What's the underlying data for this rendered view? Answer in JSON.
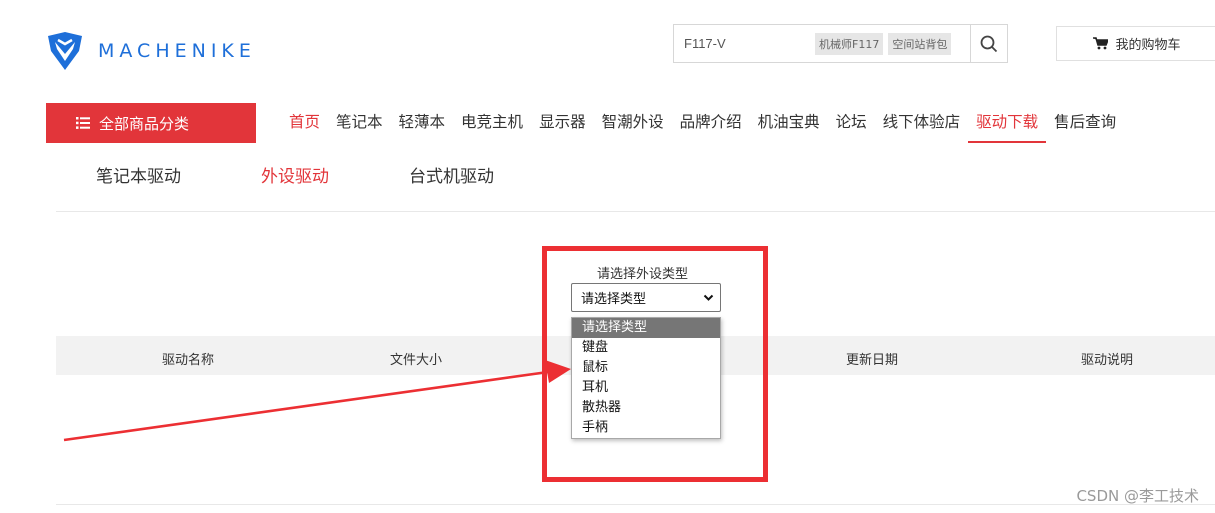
{
  "brand": {
    "name": "MACHENIKE"
  },
  "search": {
    "value": "",
    "placeholder": "F117-V",
    "hot_tags": [
      "机械师F117",
      "空间站背包"
    ]
  },
  "cart": {
    "label": "我的购物车"
  },
  "nav": {
    "all_categories": "全部商品分类",
    "items": [
      "首页",
      "笔记本",
      "轻薄本",
      "电竞主机",
      "显示器",
      "智潮外设",
      "品牌介绍",
      "机油宝典",
      "论坛",
      "线下体验店",
      "驱动下载",
      "售后查询"
    ]
  },
  "subtabs": [
    "笔记本驱动",
    "外设驱动",
    "台式机驱动"
  ],
  "selector": {
    "label": "请选择外设类型",
    "selected": "请选择类型",
    "options": [
      "请选择类型",
      "键盘",
      "鼠标",
      "耳机",
      "散热器",
      "手柄"
    ]
  },
  "table": {
    "headers": [
      "驱动名称",
      "文件大小",
      "更新日期",
      "驱动说明"
    ]
  },
  "watermark": "CSDN @李工技术",
  "colors": {
    "accent": "#e2353a",
    "brand_blue": "#1e6fd9",
    "annotation": "#ec2f33"
  }
}
